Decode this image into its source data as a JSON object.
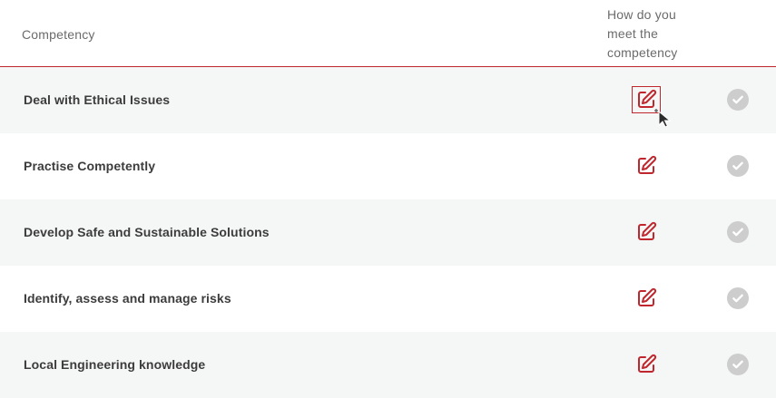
{
  "header": {
    "competency_label": "Competency",
    "how_label_lines": [
      "How do you",
      "meet the",
      "competency"
    ]
  },
  "colors": {
    "accent": "#c0262d",
    "row_shaded": "#f5f7f6",
    "check_inactive": "#cdcdcd"
  },
  "icons": {
    "edit": "edit-icon",
    "check": "check-circle-icon"
  },
  "rows": [
    {
      "label": "Deal with Ethical Issues",
      "focused": true
    },
    {
      "label": "Practise Competently",
      "focused": false
    },
    {
      "label": "Develop Safe and Sustainable Solutions",
      "focused": false
    },
    {
      "label": "Identify, assess and manage risks",
      "focused": false
    },
    {
      "label": "Local Engineering knowledge",
      "focused": false
    }
  ]
}
